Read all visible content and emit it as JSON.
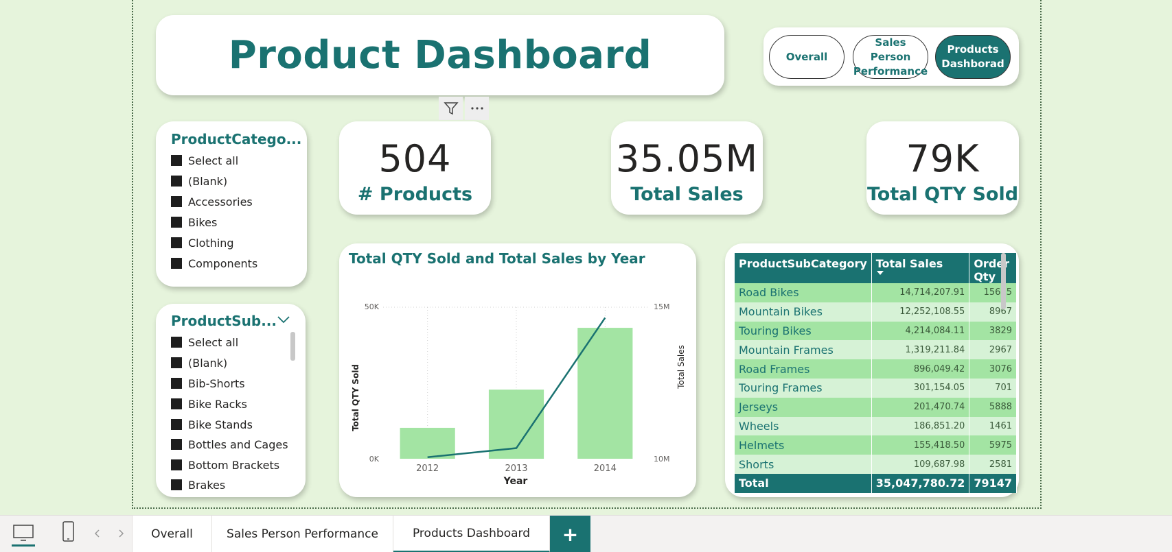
{
  "title": "Product Dashboard",
  "nav": {
    "overall": "Overall",
    "sales_line1": "Sales Person",
    "sales_line2": "Performance",
    "products_line1": "Products",
    "products_line2": "Dashborad"
  },
  "kpis": [
    {
      "value": "504",
      "label": "# Products"
    },
    {
      "value": "35.05M",
      "label": "Total Sales"
    },
    {
      "value": "79K",
      "label": "Total QTY Sold"
    }
  ],
  "slicer_category": {
    "title": "ProductCatego...",
    "items": [
      "Select all",
      "(Blank)",
      "Accessories",
      "Bikes",
      "Clothing",
      "Components"
    ]
  },
  "slicer_subcategory": {
    "title": "ProductSub...",
    "items": [
      "Select all",
      "(Blank)",
      "Bib-Shorts",
      "Bike Racks",
      "Bike Stands",
      "Bottles and Cages",
      "Bottom Brackets",
      "Brakes"
    ]
  },
  "chart_data": {
    "type": "bar",
    "title": "Total QTY Sold and Total Sales by Year",
    "categories": [
      "2012",
      "2013",
      "2014"
    ],
    "series": [
      {
        "name": "Total QTY Sold",
        "type": "bar",
        "values": [
          10200,
          22800,
          43200
        ],
        "axis": "left"
      },
      {
        "name": "Total Sales",
        "type": "line",
        "values": [
          10.05,
          10.35,
          14.65
        ],
        "axis": "right"
      }
    ],
    "xlabel": "Year",
    "ylabel": "Total QTY Sold",
    "y2label": "Total Sales",
    "ylim": [
      0,
      50000
    ],
    "y2lim": [
      10,
      15
    ],
    "yticks": [
      "0K",
      "50K"
    ],
    "y2ticks": [
      "10M",
      "15M"
    ],
    "grid": true,
    "bar_color": "#a3e4a3",
    "line_color": "#1a7271"
  },
  "table": {
    "headers": [
      "ProductSubCategory",
      "Total Sales",
      "Order Qty"
    ],
    "rows": [
      [
        "Road Bikes",
        "14,714,207.91",
        "15635"
      ],
      [
        "Mountain Bikes",
        "12,252,108.55",
        "8967"
      ],
      [
        "Touring Bikes",
        "4,214,084.11",
        "3829"
      ],
      [
        "Mountain Frames",
        "1,319,211.84",
        "2967"
      ],
      [
        "Road Frames",
        "896,049.42",
        "3076"
      ],
      [
        "Touring Frames",
        "301,154.05",
        "701"
      ],
      [
        "Jerseys",
        "201,470.74",
        "5888"
      ],
      [
        "Wheels",
        "186,851.20",
        "1461"
      ],
      [
        "Helmets",
        "155,418.50",
        "5975"
      ],
      [
        "Shorts",
        "109,687.98",
        "2581"
      ]
    ],
    "total": [
      "Total",
      "35,047,780.72",
      "79147"
    ]
  },
  "tabs": [
    "Overall",
    "Sales Person Performance",
    "Products Dashboard"
  ],
  "add_tab": "+",
  "accent_color": "#1a7271"
}
